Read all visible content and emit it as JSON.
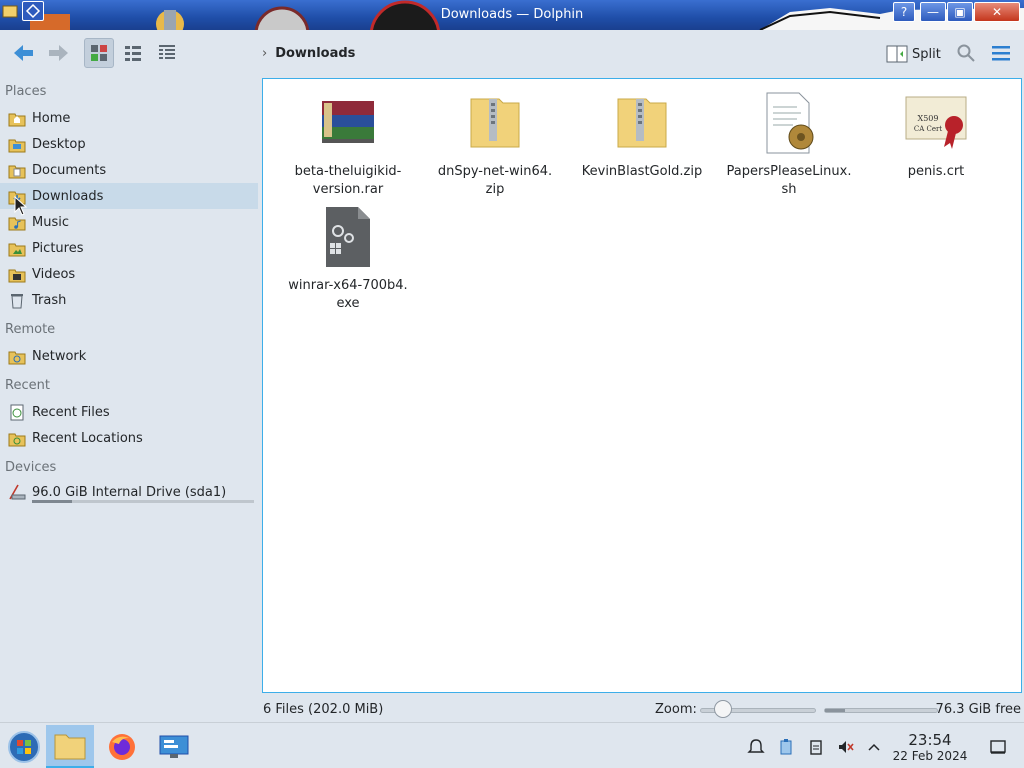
{
  "window": {
    "title": "Downloads — Dolphin"
  },
  "titlebar": {
    "help": "?",
    "minimize": "—",
    "maximize": "▣",
    "close": "✕"
  },
  "toolbar": {
    "split_label": "Split"
  },
  "breadcrumb": {
    "chevron": "›",
    "current": "Downloads"
  },
  "sidebar": {
    "places_header": "Places",
    "places": [
      {
        "label": "Home",
        "icon": "home-folder-icon"
      },
      {
        "label": "Desktop",
        "icon": "desktop-folder-icon"
      },
      {
        "label": "Documents",
        "icon": "documents-folder-icon"
      },
      {
        "label": "Downloads",
        "icon": "downloads-folder-icon",
        "selected": true
      },
      {
        "label": "Music",
        "icon": "music-folder-icon"
      },
      {
        "label": "Pictures",
        "icon": "pictures-folder-icon"
      },
      {
        "label": "Videos",
        "icon": "videos-folder-icon"
      },
      {
        "label": "Trash",
        "icon": "trash-icon"
      }
    ],
    "remote_header": "Remote",
    "remote": [
      {
        "label": "Network",
        "icon": "network-folder-icon"
      }
    ],
    "recent_header": "Recent",
    "recent": [
      {
        "label": "Recent Files",
        "icon": "recent-files-icon"
      },
      {
        "label": "Recent Locations",
        "icon": "recent-locations-icon"
      }
    ],
    "devices_header": "Devices",
    "devices": [
      {
        "label": "96.0 GiB Internal Drive (sda1)",
        "icon": "drive-icon",
        "used_fraction": 0.18
      }
    ]
  },
  "files": [
    {
      "name": "beta-theluigikid-version.rar",
      "line1": "beta-theluigikid-",
      "line2": "version.rar",
      "icon": "rar-archive-icon"
    },
    {
      "name": "dnSpy-net-win64.zip",
      "line1": "dnSpy-net-win64.",
      "line2": "zip",
      "icon": "zip-folder-icon"
    },
    {
      "name": "KevinBlastGold.zip",
      "line1": "KevinBlastGold.zip",
      "line2": "",
      "icon": "zip-folder-icon"
    },
    {
      "name": "PapersPleaseLinux.sh",
      "line1": "PapersPleaseLinux.",
      "line2": "sh",
      "icon": "shell-script-icon"
    },
    {
      "name": "penis.crt",
      "line1": "penis.crt",
      "line2": "",
      "icon": "certificate-icon"
    },
    {
      "name": "winrar-x64-700b4.exe",
      "line1": "winrar-x64-700b4.",
      "line2": "exe",
      "icon": "exe-file-icon"
    }
  ],
  "certificate_label": "X509\nCA Cert",
  "status": {
    "count": "6 Files (202.0 MiB)",
    "zoom_label": "Zoom:",
    "zoom_fraction": 0.2,
    "free_space": "76.3 GiB free",
    "used_fraction": 0.18
  },
  "clock": {
    "time": "23:54",
    "date": "22 Feb 2024"
  },
  "colors": {
    "accent": "#3daee9",
    "titlebar": "#1f4ea8",
    "selection": "#c8dae9"
  }
}
